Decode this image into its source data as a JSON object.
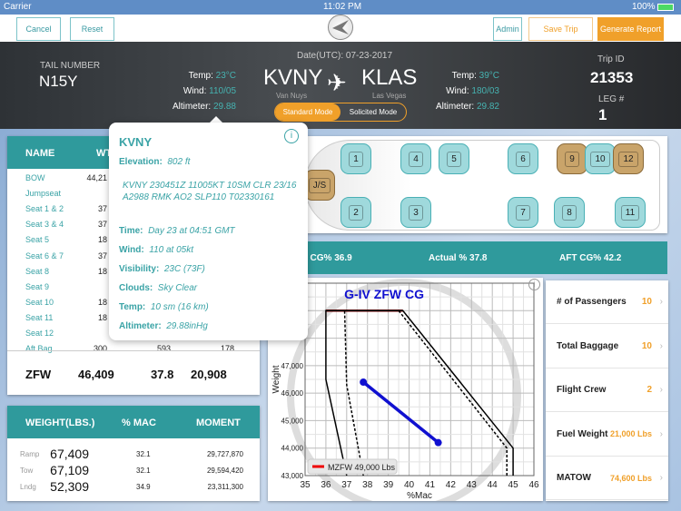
{
  "status": {
    "carrier": "Carrier",
    "time": "11:02 PM",
    "battery": "100%"
  },
  "toolbar": {
    "cancel": "Cancel",
    "reset": "Reset",
    "admin": "Admin",
    "save_trip": "Save Trip",
    "generate_report": "Generate Report"
  },
  "banner": {
    "date": "Date(UTC): 07-23-2017",
    "tail_label": "TAIL NUMBER",
    "tail": "N15Y",
    "origin": {
      "code": "KVNY",
      "city": "Van Nuys",
      "temp_label": "Temp:",
      "temp": "23°C",
      "wind_label": "Wind:",
      "wind": "110/05",
      "alt_label": "Altimeter:",
      "alt": "29.88"
    },
    "dest": {
      "code": "KLAS",
      "city": "Las Vegas",
      "temp_label": "Temp:",
      "temp": "39°C",
      "wind_label": "Wind:",
      "wind": "180/03",
      "alt_label": "Altimeter:",
      "alt": "29.82"
    },
    "mode_standard": "Standard Mode",
    "mode_solicited": "Solicited Mode",
    "trip_label": "Trip ID",
    "trip": "21353",
    "leg_label": "LEG #",
    "leg": "1"
  },
  "load_table": {
    "headers": [
      "NAME",
      "WT"
    ],
    "rows": [
      [
        "BOW",
        "44,21"
      ],
      [
        "Jumpseat",
        ""
      ],
      [
        "Seat 1 & 2",
        "37"
      ],
      [
        "Seat 3 & 4",
        "37"
      ],
      [
        "Seat 5",
        "18"
      ],
      [
        "Seat 6 & 7",
        "37"
      ],
      [
        "Seat 8",
        "18"
      ],
      [
        "Seat 9",
        ""
      ],
      [
        "Seat 10",
        "18"
      ],
      [
        "Seat 11",
        "18"
      ],
      [
        "Seat 12",
        ""
      ],
      [
        "Aft Bag",
        "300",
        "593",
        "178"
      ]
    ],
    "total": [
      "ZFW",
      "46,409",
      "37.8",
      "20,908"
    ]
  },
  "popover": {
    "title": "KVNY",
    "elev_label": "Elevation:",
    "elev": "802 ft",
    "metar": "KVNY 230451Z 11005KT 10SM CLR 23/16 A2988 RMK AO2 SLP110 T02330161",
    "time_label": "Time:",
    "time": "Day 23 at 04:51 GMT",
    "wind_label": "Wind:",
    "wind": "110 at 05kt",
    "vis_label": "Visibility:",
    "vis": "23C (73F)",
    "clouds_label": "Clouds:",
    "clouds": "Sky Clear",
    "temp_label": "Temp:",
    "temp": "10 sm (16 km)",
    "alt_label": "Altimeter:",
    "alt": "29.88inHg"
  },
  "weights": {
    "headers": [
      "WEIGHT(LBS.)",
      "% MAC",
      "MOMENT"
    ],
    "rows": [
      {
        "name": "Ramp",
        "weight": "67,409",
        "mac": "32.1",
        "moment": "29,727,870"
      },
      {
        "name": "Tow",
        "weight": "67,109",
        "mac": "32.1",
        "moment": "29,594,420"
      },
      {
        "name": "Lndg",
        "weight": "52,309",
        "mac": "34.9",
        "moment": "23,311,300"
      }
    ]
  },
  "seats": [
    {
      "label": "J/S",
      "occupied": true
    },
    {
      "label": "1",
      "occupied": false
    },
    {
      "label": "2",
      "occupied": false
    },
    {
      "label": "3",
      "occupied": false
    },
    {
      "label": "4",
      "occupied": false
    },
    {
      "label": "5",
      "occupied": false
    },
    {
      "label": "6",
      "occupied": false
    },
    {
      "label": "7",
      "occupied": false
    },
    {
      "label": "8",
      "occupied": false
    },
    {
      "label": "9",
      "occupied": true
    },
    {
      "label": "10",
      "occupied": false
    },
    {
      "label": "11",
      "occupied": false
    },
    {
      "label": "12",
      "occupied": true
    }
  ],
  "cg": {
    "fwd": "FWD CG% 36.9",
    "actual": "Actual % 37.8",
    "aft": "AFT CG% 42.2"
  },
  "summary": [
    {
      "label": "# of Passengers",
      "value": "10"
    },
    {
      "label": "Total Baggage",
      "value": "10"
    },
    {
      "label": "Flight Crew",
      "value": "2"
    },
    {
      "label": "Fuel Weight",
      "value": "21,000 Lbs"
    },
    {
      "label": "MATOW",
      "value": "74,600 Lbs"
    }
  ],
  "colors": {
    "teal": "#2f9a9c",
    "orange": "#f0a02a",
    "seat_empty": "#9fd9dc",
    "seat_occupied": "#c9a46a",
    "cg_line": "#1010d0"
  },
  "chart_data": {
    "type": "line",
    "title": "G-IV ZFW CG",
    "xlabel": "%Mac",
    "ylabel": "Weight",
    "xlim": [
      35,
      46
    ],
    "ylim": [
      43000,
      50000
    ],
    "x_ticks": [
      "35",
      "36",
      "37",
      "38",
      "39",
      "40",
      "41",
      "42",
      "43",
      "44",
      "45",
      "46"
    ],
    "y_ticks": [
      "43,000",
      "44,000",
      "45,000",
      "46,000",
      "47,000"
    ],
    "grid": true,
    "legend": {
      "entry": "MZFW 49,000 Lbs",
      "placement": "bottom-left"
    },
    "series": [
      {
        "style": "mzfw",
        "color": "#8b0000",
        "x": [
          36,
          39.7
        ],
        "y": [
          49000,
          49000
        ]
      },
      {
        "style": "envelope-solid",
        "color": "#000000",
        "x": [
          37,
          36,
          36,
          39.7,
          45,
          45
        ],
        "y": [
          43000,
          46500,
          49000,
          49000,
          44000,
          43000
        ]
      },
      {
        "style": "envelope-dashed-fwd",
        "color": "#000000",
        "x": [
          37.8,
          37,
          36.9
        ],
        "y": [
          43000,
          46300,
          49000
        ]
      },
      {
        "style": "envelope-dashed-aft",
        "color": "#000000",
        "x": [
          39.5,
          44.7,
          44.7
        ],
        "y": [
          49000,
          44000,
          43000
        ]
      },
      {
        "style": "cg-path",
        "color": "#1010d0",
        "x": [
          37.8,
          41.4
        ],
        "y": [
          46400,
          44200
        ]
      }
    ]
  }
}
